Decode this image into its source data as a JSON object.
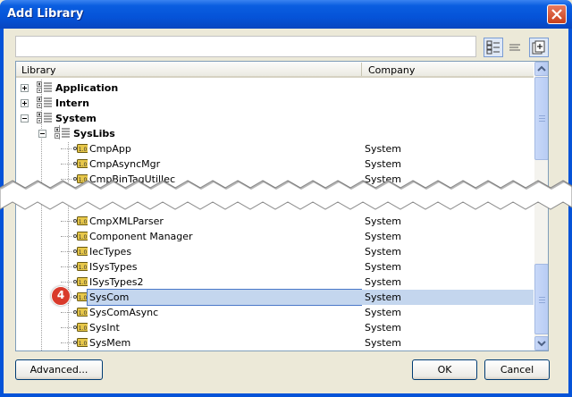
{
  "window": {
    "title": "Add Library"
  },
  "tree": {
    "columns": {
      "library": "Library",
      "company": "Company"
    },
    "rows_top": [
      {
        "label": "Application",
        "company": "",
        "level": 0,
        "bold": true,
        "type": "folder",
        "expander": "plus"
      },
      {
        "label": "Intern",
        "company": "",
        "level": 0,
        "bold": true,
        "type": "folder",
        "expander": "plus"
      },
      {
        "label": "System",
        "company": "",
        "level": 0,
        "bold": true,
        "type": "folder",
        "expander": "minus"
      },
      {
        "label": "SysLibs",
        "company": "",
        "level": 1,
        "bold": true,
        "type": "folder",
        "expander": "minus"
      },
      {
        "label": "CmpApp",
        "company": "System",
        "level": 2,
        "type": "lib"
      },
      {
        "label": "CmpAsyncMgr",
        "company": "System",
        "level": 2,
        "type": "lib"
      },
      {
        "label": "CmpBinTagUtilIec",
        "company": "System",
        "level": 2,
        "type": "lib"
      }
    ],
    "rows_bottom": [
      {
        "label": "CmpXMLParser",
        "company": "System",
        "level": 2,
        "type": "lib"
      },
      {
        "label": "Component Manager",
        "company": "System",
        "level": 2,
        "type": "lib"
      },
      {
        "label": "IecTypes",
        "company": "System",
        "level": 2,
        "type": "lib"
      },
      {
        "label": "ISysTypes",
        "company": "System",
        "level": 2,
        "type": "lib"
      },
      {
        "label": "ISysTypes2",
        "company": "System",
        "level": 2,
        "type": "lib"
      },
      {
        "label": "SysCom",
        "company": "System",
        "level": 2,
        "type": "lib",
        "selected": true
      },
      {
        "label": "SysComAsync",
        "company": "System",
        "level": 2,
        "type": "lib"
      },
      {
        "label": "SysInt",
        "company": "System",
        "level": 2,
        "type": "lib"
      },
      {
        "label": "SysMem",
        "company": "System",
        "level": 2,
        "type": "lib"
      }
    ]
  },
  "callout": {
    "number": "4"
  },
  "buttons": {
    "advanced": "Advanced...",
    "ok": "OK",
    "cancel": "Cancel"
  },
  "icons": {
    "close": "close-icon",
    "view_tree": "tree-view-icon",
    "view_list": "list-view-icon",
    "new_library": "add-library-icon"
  },
  "colors": {
    "titlebar": "#0553d8",
    "selection": "#c4d6ee",
    "callout": "#d93a2b",
    "library_icon": "#e8c84a"
  }
}
